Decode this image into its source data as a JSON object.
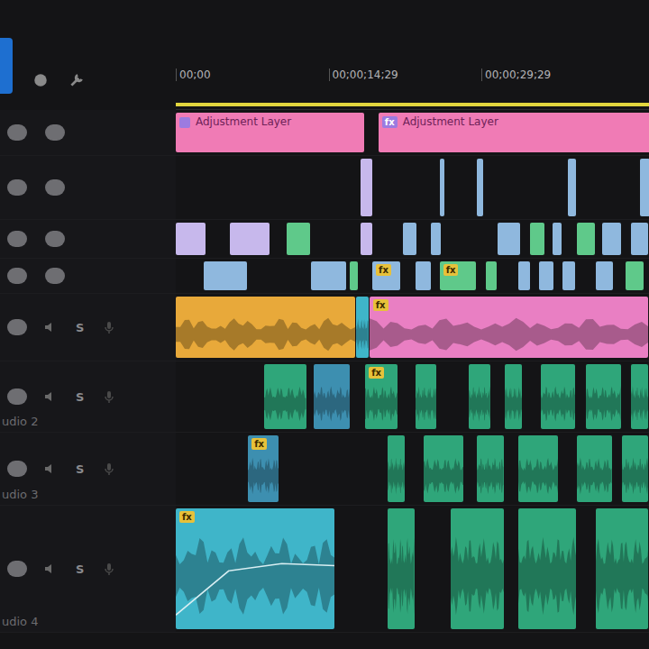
{
  "ruler": {
    "timecodes": [
      {
        "text": "00;00",
        "seconds": 0
      },
      {
        "text": "00;00;14;29",
        "seconds": 15
      },
      {
        "text": "00;00;29;29",
        "seconds": 30
      }
    ]
  },
  "work_area": {
    "start": 0,
    "duration": 46.5
  },
  "tracks": [
    {
      "kind": "adjust",
      "clips": [
        {
          "start": 0,
          "duration": 18.6,
          "color": "#f07bb5",
          "label": "Adjustment Layer"
        },
        {
          "start": 19.9,
          "duration": 27,
          "color": "#f07bb5",
          "label": "Adjustment Layer",
          "badge": "fx"
        }
      ]
    },
    {
      "kind": "video",
      "clips": [
        {
          "start": 18.1,
          "duration": 1.3,
          "color": "#c7b8ec"
        },
        {
          "start": 25.9,
          "duration": 0.6,
          "color": "#8fb8de"
        },
        {
          "start": 29.6,
          "duration": 0.7,
          "color": "#8fb8de"
        },
        {
          "start": 38.5,
          "duration": 0.9,
          "color": "#8fb8de"
        },
        {
          "start": 45.6,
          "duration": 1,
          "color": "#8fb8de"
        }
      ]
    },
    {
      "kind": "video",
      "clips": [
        {
          "start": 0,
          "duration": 3,
          "color": "#c7b8ec"
        },
        {
          "start": 5.3,
          "duration": 4,
          "color": "#c7b8ec"
        },
        {
          "start": 10.9,
          "duration": 2.4,
          "color": "#5fc98a"
        },
        {
          "start": 18.1,
          "duration": 1.3,
          "color": "#c7b8ec"
        },
        {
          "start": 22.3,
          "duration": 1.4,
          "color": "#8fb8de"
        },
        {
          "start": 25,
          "duration": 1.1,
          "color": "#8fb8de"
        },
        {
          "start": 31.6,
          "duration": 2.3,
          "color": "#8fb8de"
        },
        {
          "start": 34.8,
          "duration": 1.5,
          "color": "#5fc98a"
        },
        {
          "start": 37,
          "duration": 1,
          "color": "#8fb8de"
        },
        {
          "start": 39.4,
          "duration": 1.8,
          "color": "#5fc98a"
        },
        {
          "start": 41.9,
          "duration": 1.9,
          "color": "#8fb8de"
        },
        {
          "start": 44.7,
          "duration": 1.8,
          "color": "#8fb8de"
        }
      ]
    },
    {
      "kind": "video",
      "clips": [
        {
          "start": 2.7,
          "duration": 4.4,
          "color": "#8fb8de"
        },
        {
          "start": 13.3,
          "duration": 3.5,
          "color": "#8fb8de"
        },
        {
          "start": 17.1,
          "duration": 0.9,
          "color": "#5fc98a"
        },
        {
          "start": 19.3,
          "duration": 2.8,
          "color": "#8fb8de",
          "badge": "fx"
        },
        {
          "start": 23.5,
          "duration": 1.6,
          "color": "#8fb8de"
        },
        {
          "start": 25.9,
          "duration": 3.7,
          "color": "#5fc98a",
          "badge": "fx"
        },
        {
          "start": 30.4,
          "duration": 1.2,
          "color": "#5fc98a"
        },
        {
          "start": 33.6,
          "duration": 1.3,
          "color": "#8fb8de"
        },
        {
          "start": 35.7,
          "duration": 1.5,
          "color": "#8fb8de"
        },
        {
          "start": 38,
          "duration": 1.3,
          "color": "#8fb8de"
        },
        {
          "start": 41.2,
          "duration": 1.8,
          "color": "#8fb8de"
        },
        {
          "start": 44.2,
          "duration": 1.8,
          "color": "#5fc98a"
        }
      ]
    },
    {
      "kind": "audio",
      "solo": "S",
      "clips": [
        {
          "start": 0,
          "duration": 17.7,
          "color": "#e8a93a"
        },
        {
          "start": 17.7,
          "duration": 1.3,
          "color": "#3fb5c9"
        },
        {
          "start": 19,
          "duration": 27.5,
          "color": "#e97fc3",
          "badge": "fx"
        }
      ]
    },
    {
      "kind": "audio",
      "solo": "S",
      "name": "udio 2",
      "clips": [
        {
          "start": 8.7,
          "duration": 4.2,
          "color": "#2fa67a"
        },
        {
          "start": 13.5,
          "duration": 3.7,
          "color": "#3d8fb0"
        },
        {
          "start": 18.6,
          "duration": 3.3,
          "color": "#2fa67a",
          "badge": "fx"
        },
        {
          "start": 23.5,
          "duration": 2.2,
          "color": "#2fa67a"
        },
        {
          "start": 28.8,
          "duration": 2.2,
          "color": "#2fa67a"
        },
        {
          "start": 32.3,
          "duration": 1.8,
          "color": "#2fa67a"
        },
        {
          "start": 35.8,
          "duration": 3.5,
          "color": "#2fa67a"
        },
        {
          "start": 40.3,
          "duration": 3.5,
          "color": "#2fa67a"
        },
        {
          "start": 44.7,
          "duration": 1.8,
          "color": "#2fa67a"
        }
      ]
    },
    {
      "kind": "audio",
      "solo": "S",
      "name": "udio 3",
      "clips": [
        {
          "start": 7.1,
          "duration": 3.1,
          "color": "#3d8fb0",
          "badge": "fx"
        },
        {
          "start": 20.8,
          "duration": 1.8,
          "color": "#2fa67a"
        },
        {
          "start": 24.3,
          "duration": 4,
          "color": "#2fa67a"
        },
        {
          "start": 29.6,
          "duration": 2.7,
          "color": "#2fa67a"
        },
        {
          "start": 33.6,
          "duration": 4,
          "color": "#2fa67a"
        },
        {
          "start": 39.4,
          "duration": 3.5,
          "color": "#2fa67a"
        },
        {
          "start": 43.8,
          "duration": 2.7,
          "color": "#2fa67a"
        }
      ]
    },
    {
      "kind": "audio",
      "solo": "S",
      "name": "udio 4",
      "clips": [
        {
          "start": 0,
          "duration": 15.7,
          "color": "#3fb5c9",
          "badge": "fx",
          "keyframes": [
            0.12,
            0.55,
            0.62,
            0.6
          ]
        },
        {
          "start": 20.8,
          "duration": 2.7,
          "color": "#2fa67a"
        },
        {
          "start": 27,
          "duration": 5.3,
          "color": "#2fa67a"
        },
        {
          "start": 33.6,
          "duration": 5.8,
          "color": "#2fa67a"
        },
        {
          "start": 41.2,
          "duration": 5.3,
          "color": "#2fa67a"
        }
      ]
    }
  ]
}
